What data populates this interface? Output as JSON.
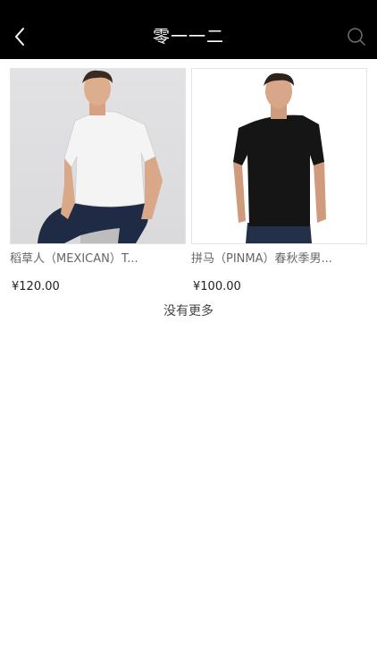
{
  "header": {
    "title": "零一一二",
    "back_icon": "chevron-left-icon",
    "search_icon": "search-icon"
  },
  "products": [
    {
      "name": "稻草人（MEXICAN）T...",
      "price": "¥120.00",
      "shirt_color": "#f4f4f4"
    },
    {
      "name": "拼马（PINMA）春秋季男...",
      "price": "¥100.00",
      "shirt_color": "#151515"
    }
  ],
  "footer": {
    "no_more": "没有更多"
  }
}
